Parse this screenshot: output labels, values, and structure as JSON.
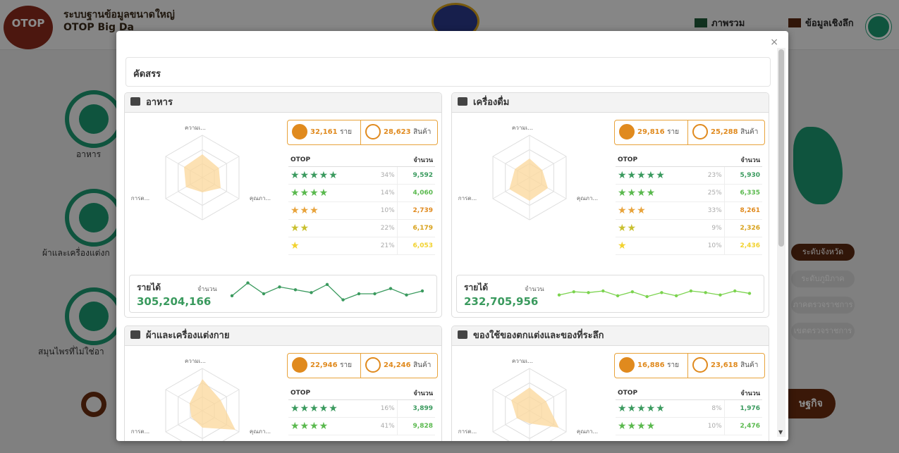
{
  "app": {
    "title_line1": "ระบบฐานข้อมูลขนาดใหญ่",
    "title_line2": "OTOP Big Da",
    "logo_text": "OTOP",
    "nav": [
      {
        "label": "ภาพรวม"
      },
      {
        "label": "ข้อมูลเชิงลึก"
      }
    ]
  },
  "background": {
    "categories": [
      {
        "label": "อาหาร"
      },
      {
        "label": "ผ้าและเครื่องแต่งก"
      },
      {
        "label": "สมุนไพรที่ไม่ใช่อา"
      }
    ],
    "levels": [
      "ระดับจังหวัด",
      "ระดับภูมิภาค",
      "ภาคตรวจราชการ",
      "เขตตรวจราชการ"
    ],
    "big_button": "ษฐกิจ"
  },
  "modal": {
    "close_label": "×",
    "header": "คัดสรร",
    "panels": [
      {
        "title": "อาหาร",
        "icon": "food-basket-icon",
        "radar_labels": [
          "ความเ...",
          "คุณภา...",
          "การต..."
        ],
        "radar_values": [
          0.55,
          0.45,
          0.5,
          0.35,
          0.45,
          0.5
        ],
        "entrepreneurs": "32,161",
        "entrepreneurs_unit": "ราย",
        "products": "28,623",
        "products_unit": "สินค้า",
        "table_header": {
          "otop": "OTOP",
          "count": "จำนวน"
        },
        "rows": [
          {
            "stars": 5,
            "pct": "34%",
            "count": "9,592"
          },
          {
            "stars": 4,
            "pct": "14%",
            "count": "4,060"
          },
          {
            "stars": 3,
            "pct": "10%",
            "count": "2,739"
          },
          {
            "stars": 2,
            "pct": "22%",
            "count": "6,179"
          },
          {
            "stars": 1,
            "pct": "21%",
            "count": "6,053"
          }
        ],
        "revenue_label": "รายได้",
        "revenue_count_label": "จำนวน",
        "revenue": "305,204,166",
        "revenue_line_color": "#3a9a5e",
        "sparkline": [
          30,
          62,
          35,
          52,
          45,
          38,
          58,
          20,
          35,
          35,
          48,
          32,
          42
        ]
      },
      {
        "title": "เครื่องดื่ม",
        "icon": "bottle-icon",
        "radar_labels": [
          "ความเ...",
          "คุณภา...",
          "การต..."
        ],
        "radar_values": [
          0.45,
          0.35,
          0.5,
          0.55,
          0.55,
          0.4
        ],
        "entrepreneurs": "29,816",
        "entrepreneurs_unit": "ราย",
        "products": "25,288",
        "products_unit": "สินค้า",
        "table_header": {
          "otop": "OTOP",
          "count": "จำนวน"
        },
        "rows": [
          {
            "stars": 5,
            "pct": "23%",
            "count": "5,930"
          },
          {
            "stars": 4,
            "pct": "25%",
            "count": "6,335"
          },
          {
            "stars": 3,
            "pct": "33%",
            "count": "8,261"
          },
          {
            "stars": 2,
            "pct": "9%",
            "count": "2,326"
          },
          {
            "stars": 1,
            "pct": "10%",
            "count": "2,436"
          }
        ],
        "revenue_label": "รายได้",
        "revenue_count_label": "จำนวน",
        "revenue": "232,705,956",
        "revenue_line_color": "#7bd34e",
        "sparkline": [
          32,
          40,
          38,
          42,
          30,
          40,
          28,
          38,
          30,
          42,
          38,
          32,
          42,
          36
        ]
      },
      {
        "title": "ผ้าและเครื่องแต่งกาย",
        "icon": "shirt-icon",
        "radar_labels": [
          "ความเ...",
          "คุณภา...",
          "การต..."
        ],
        "radar_values": [
          0.75,
          0.5,
          0.9,
          0.4,
          0.3,
          0.35
        ],
        "entrepreneurs": "22,946",
        "entrepreneurs_unit": "ราย",
        "products": "24,246",
        "products_unit": "สินค้า",
        "table_header": {
          "otop": "OTOP",
          "count": "จำนวน"
        },
        "rows": [
          {
            "stars": 5,
            "pct": "16%",
            "count": "3,899"
          },
          {
            "stars": 4,
            "pct": "41%",
            "count": "9,828"
          }
        ]
      },
      {
        "title": "ของใช้ของตกแต่งและของที่ระลึก",
        "icon": "vase-icon",
        "radar_labels": [
          "ความเ...",
          "คุณภา...",
          "การต..."
        ],
        "radar_values": [
          0.55,
          0.45,
          0.8,
          0.3,
          0.35,
          0.5
        ],
        "entrepreneurs": "16,886",
        "entrepreneurs_unit": "ราย",
        "products": "23,618",
        "products_unit": "สินค้า",
        "table_header": {
          "otop": "OTOP",
          "count": "จำนวน"
        },
        "rows": [
          {
            "stars": 5,
            "pct": "8%",
            "count": "1,976"
          },
          {
            "stars": 4,
            "pct": "10%",
            "count": "2,476"
          }
        ]
      }
    ]
  }
}
